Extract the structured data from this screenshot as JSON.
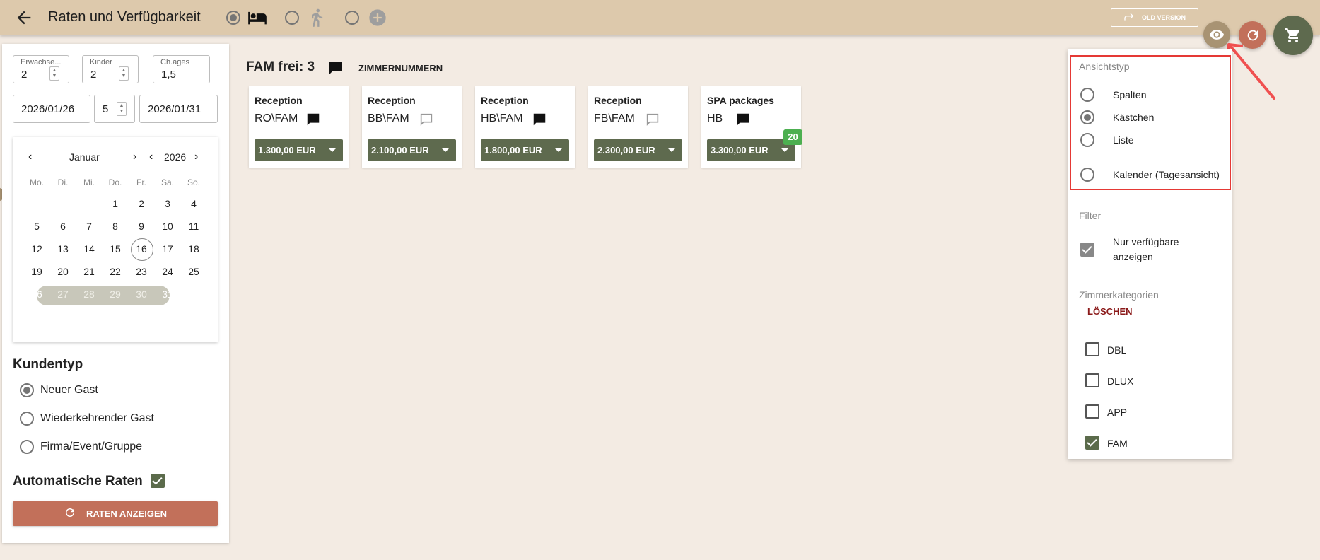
{
  "header": {
    "title": "Raten und Verfügbarkeit",
    "old_version_label": "OLD VERSION",
    "icons": [
      "arrow-back-icon",
      "bed-icon",
      "walk-icon",
      "add-circle-icon",
      "eye-icon",
      "refresh-icon",
      "cart-icon"
    ],
    "colors": {
      "bar": "#ddc9ac",
      "eye_fab": "#a89373",
      "refresh_fab": "#c2705a",
      "cart_fab": "#5e6a4e"
    }
  },
  "search": {
    "adults_label": "Erwachse...",
    "adults_value": "2",
    "children_label": "Kinder",
    "children_value": "2",
    "child_ages_label": "Ch.ages",
    "child_ages_value": "1,5",
    "arrival": "2026/01/26",
    "nights": "5",
    "departure": "2026/01/31"
  },
  "calendar": {
    "month": "Januar",
    "year": "2026",
    "weekdays": [
      "Mo.",
      "Di.",
      "Mi.",
      "Do.",
      "Fr.",
      "Sa.",
      "So."
    ],
    "weeks": [
      [
        "",
        "",
        "",
        "1",
        "2",
        "3",
        "4"
      ],
      [
        "5",
        "6",
        "7",
        "8",
        "9",
        "10",
        "11"
      ],
      [
        "12",
        "13",
        "14",
        "15",
        "16",
        "17",
        "18"
      ],
      [
        "19",
        "20",
        "21",
        "22",
        "23",
        "24",
        "25"
      ],
      [
        "26",
        "27",
        "28",
        "29",
        "30",
        "31",
        ""
      ]
    ],
    "today": "16",
    "range_start": "26",
    "range_end": "31"
  },
  "customer_type": {
    "heading": "Kundentyp",
    "options": [
      "Neuer Gast",
      "Wiederkehrender Gast",
      "Firma/Event/Gruppe"
    ],
    "selected": "Neuer Gast"
  },
  "auto_rates": {
    "label": "Automatische Raten",
    "checked": true
  },
  "show_rates_button": "RATEN ANZEIGEN",
  "main": {
    "title": "FAM frei: 3",
    "room_numbers_label": "ZIMMERNUMMERN",
    "cards": [
      {
        "title": "Reception",
        "code": "RO\\FAM",
        "comment_filled": true,
        "price": "1.300,00 EUR"
      },
      {
        "title": "Reception",
        "code": "BB\\FAM",
        "comment_filled": false,
        "price": "2.100,00 EUR"
      },
      {
        "title": "Reception",
        "code": "HB\\FAM",
        "comment_filled": true,
        "price": "1.800,00 EUR"
      },
      {
        "title": "Reception",
        "code": "FB\\FAM",
        "comment_filled": false,
        "price": "2.300,00 EUR"
      },
      {
        "title": "SPA packages",
        "code": "HB",
        "comment_filled": true,
        "price": "3.300,00 EUR",
        "badge": "20"
      }
    ]
  },
  "view_menu": {
    "view_type_heading": "Ansichtstyp",
    "view_options": [
      "Spalten",
      "Kästchen",
      "Liste",
      "Kalender (Tagesansicht)"
    ],
    "selected_view": "Kästchen",
    "filter_heading": "Filter",
    "only_available_label_line1": "Nur verfügbare",
    "only_available_label_line2": "anzeigen",
    "only_available_checked": true,
    "room_categories_heading": "Zimmerkategorien",
    "clear_label": "LÖSCHEN",
    "categories": [
      {
        "name": "DBL",
        "checked": false
      },
      {
        "name": "DLUX",
        "checked": false
      },
      {
        "name": "APP",
        "checked": false
      },
      {
        "name": "FAM",
        "checked": true
      }
    ]
  }
}
